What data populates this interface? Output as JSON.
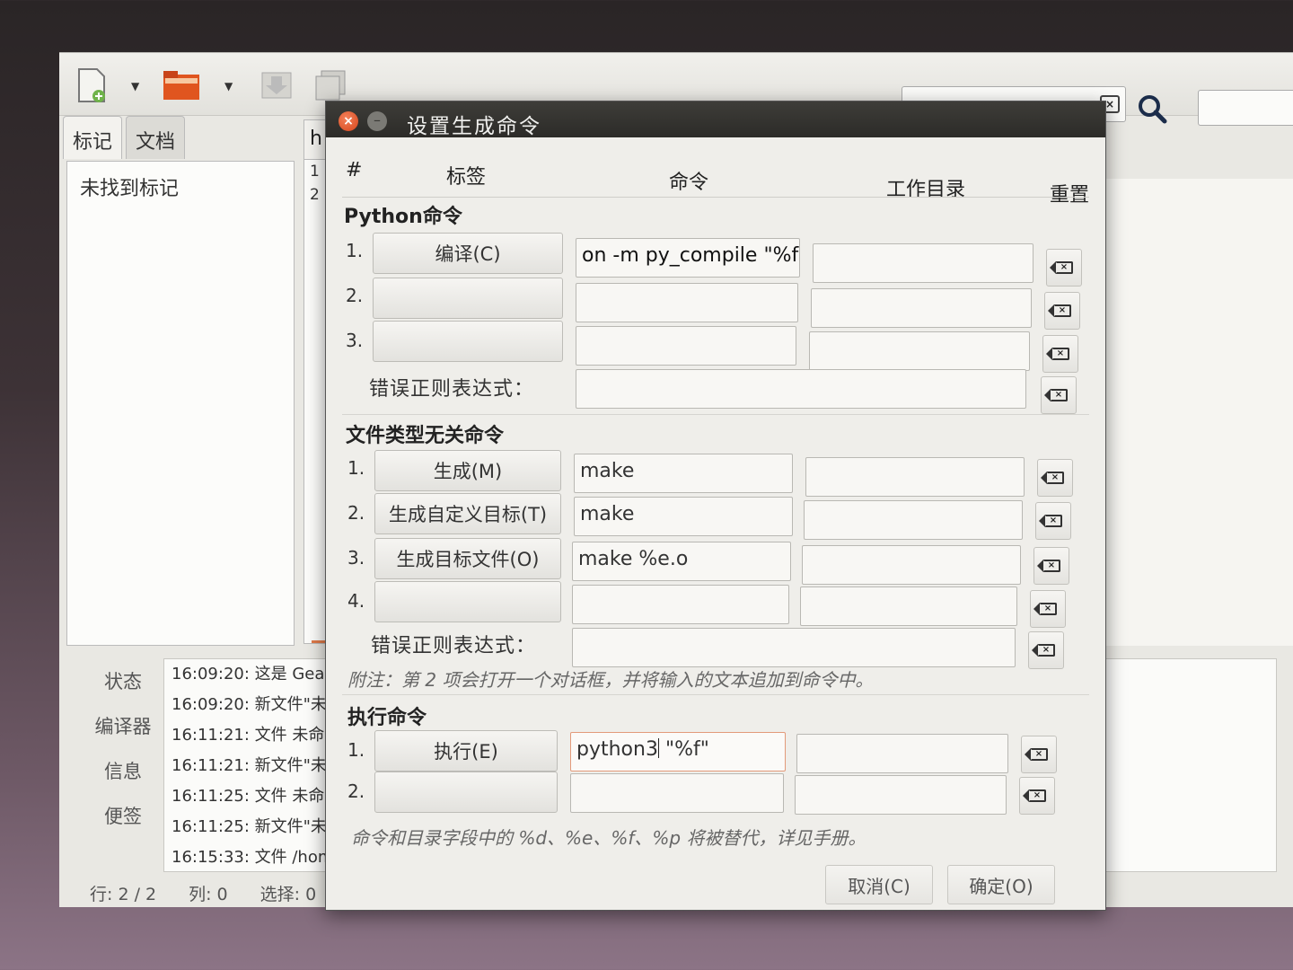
{
  "main": {
    "side_tabs": [
      "标记",
      "文档"
    ],
    "side_panel_message": "未找到标记",
    "editor_tab": "h",
    "editor_lines": [
      "1",
      "2"
    ],
    "bottom_tabs": [
      "状态",
      "编译器",
      "信息",
      "便签"
    ],
    "log_lines": [
      "16:09:20: 这是 Geany",
      "16:09:20: 新文件\"未命",
      "16:11:21: 文件 未命名",
      "16:11:21: 新文件\"未命",
      "16:11:25: 文件 未命名",
      "16:11:25: 新文件\"未命",
      "16:15:33: 文件 /home"
    ],
    "status": {
      "line": "行: 2 / 2",
      "col": "列: 0",
      "sel": "选择: 0"
    }
  },
  "dialog": {
    "title": "设置生成命令",
    "headers": {
      "num": "#",
      "label": "标签",
      "command": "命令",
      "workdir": "工作目录",
      "reset": "重置"
    },
    "python": {
      "section": "Python命令",
      "rows": [
        {
          "num": "1.",
          "label": "编译(C)",
          "command": "on -m py_compile \"%f\"",
          "workdir": ""
        },
        {
          "num": "2.",
          "label": "",
          "command": "",
          "workdir": ""
        },
        {
          "num": "3.",
          "label": "",
          "command": "",
          "workdir": ""
        }
      ],
      "regex_label": "错误正则表达式：",
      "regex_value": ""
    },
    "independent": {
      "section": "文件类型无关命令",
      "rows": [
        {
          "num": "1.",
          "label": "生成(M)",
          "command": "make",
          "workdir": ""
        },
        {
          "num": "2.",
          "label": "生成自定义目标(T)",
          "command": "make",
          "workdir": ""
        },
        {
          "num": "3.",
          "label": "生成目标文件(O)",
          "command": "make %e.o",
          "workdir": ""
        },
        {
          "num": "4.",
          "label": "",
          "command": "",
          "workdir": ""
        }
      ],
      "regex_label": "错误正则表达式：",
      "regex_value": "",
      "note": "附注：第 2 项会打开一个对话框，并将输入的文本追加到命令中。"
    },
    "execute": {
      "section": "执行命令",
      "rows": [
        {
          "num": "1.",
          "label": "执行(E)",
          "command_before_caret": "python3",
          "command_after_caret": " \"%f\"",
          "workdir": ""
        },
        {
          "num": "2.",
          "label": "",
          "command": "",
          "workdir": ""
        }
      ]
    },
    "footer_note": "命令和目录字段中的 %d、%e、%f、%p 将被替代，详见手册。",
    "cancel_label": "取消(C)",
    "ok_label": "确定(O)"
  }
}
